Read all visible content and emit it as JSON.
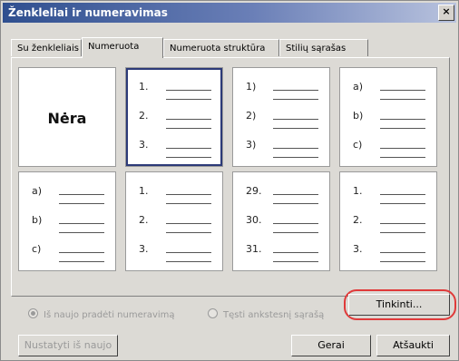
{
  "window": {
    "title": "Ženkleliai ir numeravimas",
    "close_label": "×"
  },
  "tabs": [
    {
      "label": "Su ženkleliais",
      "active": false
    },
    {
      "label": "Numeruota",
      "active": true
    },
    {
      "label": "Numeruota struktūra",
      "active": false
    },
    {
      "label": "Stilių sąrašas",
      "active": false
    }
  ],
  "gallery": {
    "none_label": "Nėra",
    "cells": [
      {
        "type": "none"
      },
      {
        "type": "list",
        "markers": [
          "1.",
          "2.",
          "3."
        ],
        "selected": true
      },
      {
        "type": "list",
        "markers": [
          "1)",
          "2)",
          "3)"
        ]
      },
      {
        "type": "list",
        "markers": [
          "a)",
          "b)",
          "c)"
        ]
      },
      {
        "type": "list",
        "markers": [
          "a)",
          "b)",
          "c)"
        ]
      },
      {
        "type": "list",
        "markers": [
          "1.",
          "2.",
          "3."
        ]
      },
      {
        "type": "list",
        "markers": [
          "29.",
          "30.",
          "31."
        ]
      },
      {
        "type": "list",
        "markers": [
          "1.",
          "2.",
          "3."
        ]
      }
    ]
  },
  "options": {
    "restart_label": "Iš naujo pradėti numeravimą",
    "restart_checked": true,
    "continue_label": "Tęsti ankstesnį sąrašą",
    "continue_checked": false
  },
  "buttons": {
    "customize": "Tinkinti...",
    "reset": "Nustatyti iš naujo",
    "ok": "Gerai",
    "cancel": "Atšaukti"
  }
}
